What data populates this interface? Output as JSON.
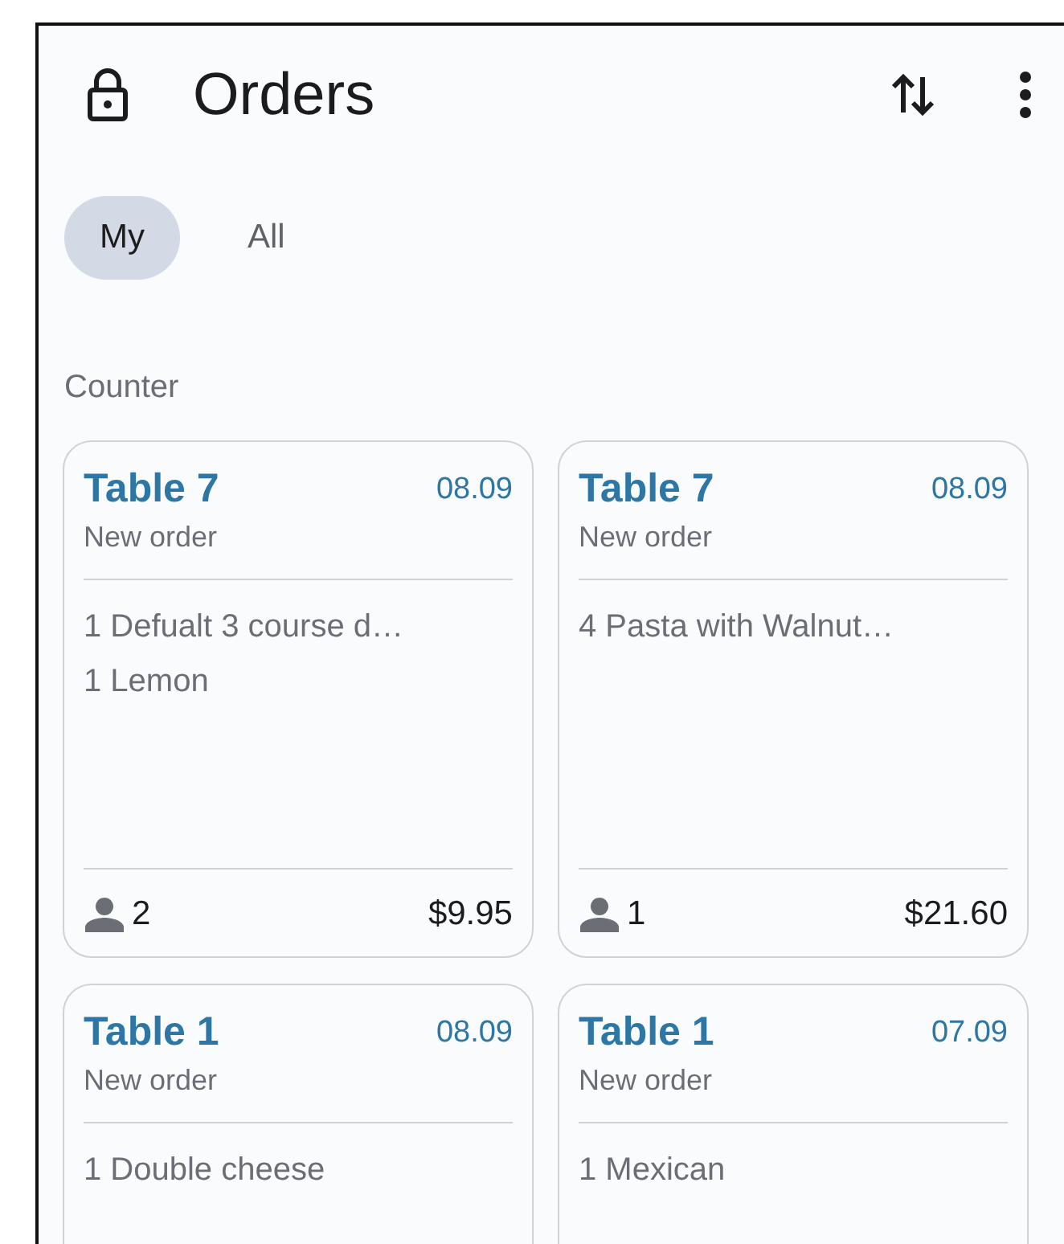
{
  "app_bar": {
    "title": "Orders"
  },
  "tabs": [
    {
      "label": "My",
      "selected": true
    },
    {
      "label": "All",
      "selected": false
    }
  ],
  "section": {
    "title": "Counter"
  },
  "orders": [
    {
      "table": "Table 7",
      "date": "08.09",
      "status": "New order",
      "items": [
        "1 Defualt 3 course d…",
        "1 Lemon"
      ],
      "guests": "2",
      "total": "$9.95"
    },
    {
      "table": "Table 7",
      "date": "08.09",
      "status": "New order",
      "items": [
        "4 Pasta with Walnut…"
      ],
      "guests": "1",
      "total": "$21.60"
    },
    {
      "table": "Table 1",
      "date": "08.09",
      "status": "New order",
      "items": [
        "1 Double cheese"
      ]
    },
    {
      "table": "Table 1",
      "date": "07.09",
      "status": "New order",
      "items": [
        "1 Mexican"
      ]
    }
  ]
}
